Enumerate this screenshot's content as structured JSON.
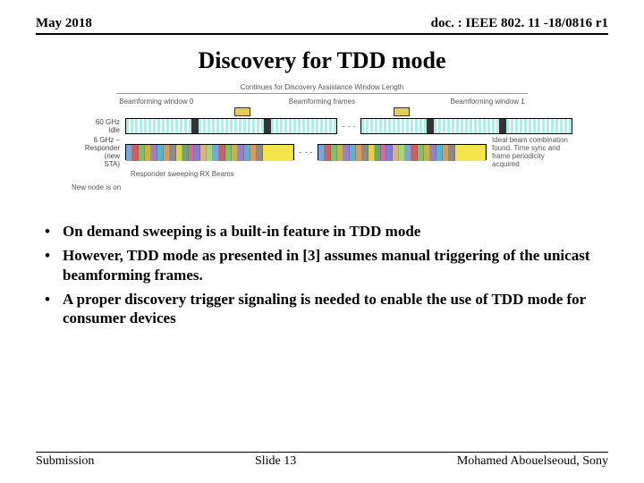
{
  "header": {
    "date": "May 2018",
    "doc": "doc. : IEEE 802. 11 -18/0816 r1"
  },
  "title": "Discovery for TDD mode",
  "diagram": {
    "top_span": "Continues for Discovery Assistance Window Length",
    "win0": "Beamforming window 0",
    "win1": "Beamforming window 1",
    "bf_frames": "Beamforming frames",
    "ch60_a": "60 GHz",
    "ch60_b": "Idle",
    "ch6_a": "6 GHz –",
    "ch6_b": "Responder (new",
    "ch6_c": "STA)",
    "rx_sweep": "Responder sweeping RX Beams",
    "ideal": "Ideal beam combination found. Time sync and frame periodicity acquired",
    "new_node": "New node is on",
    "ellipsis": "· · ·"
  },
  "bullets": [
    "On demand sweeping is a built-in feature in TDD mode",
    "However, TDD mode as presented in [3] assumes manual triggering of the unicast beamforming frames.",
    "A proper discovery trigger signaling is needed to enable the use of TDD mode for consumer devices"
  ],
  "footer": {
    "left": "Submission",
    "center": "Slide 13",
    "right": "Mohamed Abouelseoud, Sony"
  },
  "colors": [
    "#7aa6d8",
    "#d25f5f",
    "#7fbf6a",
    "#c9b24a",
    "#9a7fc9",
    "#5fb3c9",
    "#d59b5f",
    "#8a8a8a",
    "#e0d24a",
    "#6fa36f",
    "#c96fa3",
    "#7f7fd8",
    "#d8b37f",
    "#a3d87f"
  ]
}
